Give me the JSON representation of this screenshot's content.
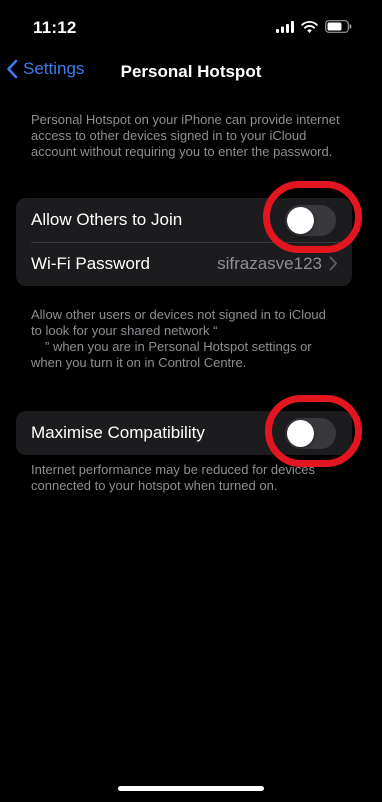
{
  "status_bar": {
    "time": "11:12"
  },
  "nav": {
    "back_label": "Settings",
    "title": "Personal Hotspot"
  },
  "intro_note": "Personal Hotspot on your iPhone can provide internet access to other devices signed in to your iCloud account without requiring you to enter the password.",
  "group1": {
    "allow_label": "Allow Others to Join",
    "allow_on": false,
    "wifi_label": "Wi-Fi Password",
    "wifi_value": "sifrazasve123"
  },
  "group1_note_line1": "Allow other users or devices not signed in to iCloud",
  "group1_note_line2": "to look for your shared network “",
  "group1_note_line3": "” when you are in Personal Hotspot settings or",
  "group1_note_line4": "when you turn it on in Control Centre.",
  "group2": {
    "compat_label": "Maximise Compatibility",
    "compat_on": false
  },
  "group2_note": "Internet performance may be reduced for devices connected to your hotspot when turned on.",
  "colors": {
    "accent": "#3f7cf0",
    "annotation": "#e3161f",
    "cell": "#1c1c1e",
    "toggle_off": "#39393d"
  }
}
